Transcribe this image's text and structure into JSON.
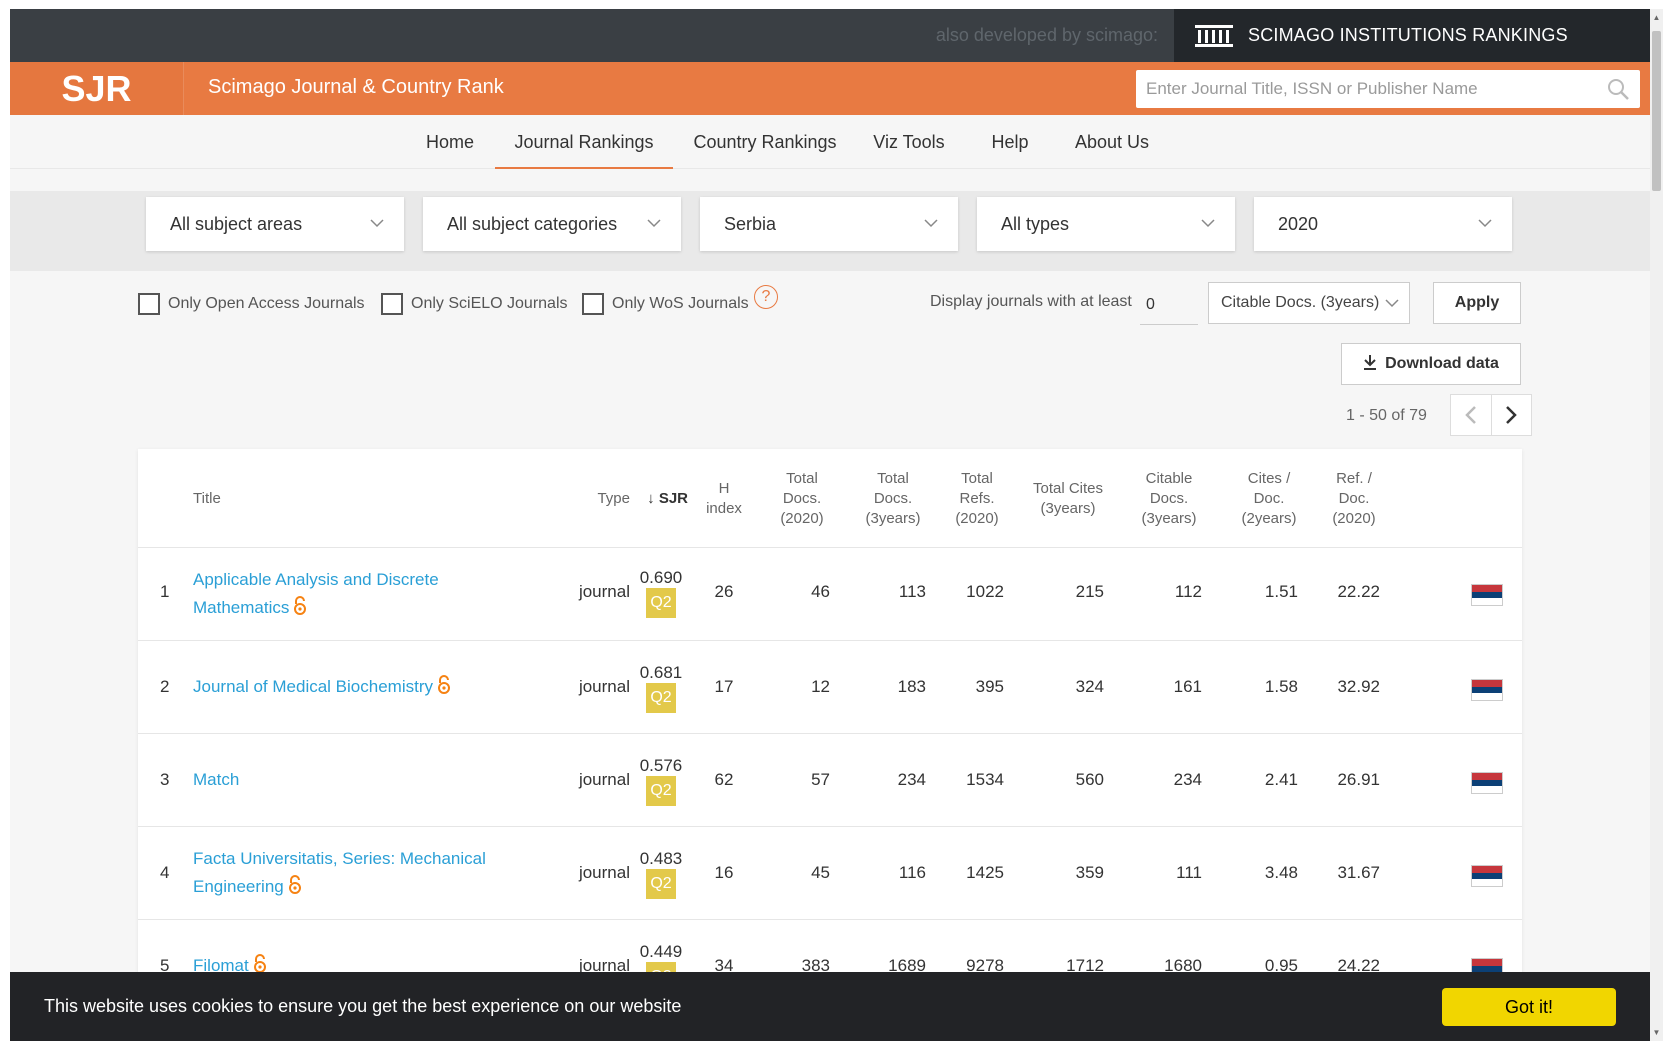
{
  "topbar": {
    "also_developed": "also developed by scimago:",
    "sir_label": "SCIMAGO INSTITUTIONS RANKINGS"
  },
  "header": {
    "logo": "SJR",
    "site_name": "Scimago Journal & Country Rank",
    "search_placeholder": "Enter Journal Title, ISSN or Publisher Name"
  },
  "nav": [
    "Home",
    "Journal Rankings",
    "Country Rankings",
    "Viz Tools",
    "Help",
    "About Us"
  ],
  "nav_active": "Journal Rankings",
  "filters": {
    "subject_area": "All subject areas",
    "subject_category": "All subject categories",
    "country": "Serbia",
    "type": "All types",
    "year": "2020"
  },
  "options": {
    "open_access": "Only Open Access Journals",
    "scielo": "Only SciELO Journals",
    "wos": "Only WoS Journals",
    "help_glyph": "?",
    "display_label": "Display journals with at least",
    "min_value": "0",
    "citable_select": "Citable Docs. (3years)",
    "apply": "Apply",
    "download": "Download data"
  },
  "pagination": {
    "info": "1 - 50 of 79"
  },
  "table": {
    "headers": {
      "title": "Title",
      "type": "Type",
      "sjr": "SJR",
      "h_index": [
        "H",
        "index"
      ],
      "total_docs_2020": [
        "Total",
        "Docs.",
        "(2020)"
      ],
      "total_docs_3y": [
        "Total",
        "Docs.",
        "(3years)"
      ],
      "total_refs": [
        "Total",
        "Refs.",
        "(2020)"
      ],
      "total_cites": [
        "Total Cites",
        "(3years)"
      ],
      "citable_docs": [
        "Citable",
        "Docs.",
        "(3years)"
      ],
      "cites_doc": [
        "Cites /",
        "Doc.",
        "(2years)"
      ],
      "ref_doc": [
        "Ref. /",
        "Doc.",
        "(2020)"
      ]
    },
    "rows": [
      {
        "rank": "1",
        "title_lines": [
          "Applicable Analysis and Discrete",
          "Mathematics"
        ],
        "open_access": true,
        "type": "journal",
        "sjr": "0.690",
        "quartile": "Q2",
        "h_index": "26",
        "total_docs_2020": "46",
        "total_docs_3y": "113",
        "total_refs": "1022",
        "total_cites": "215",
        "citable_docs": "112",
        "cites_doc": "1.51",
        "ref_doc": "22.22"
      },
      {
        "rank": "2",
        "title_lines": [
          "Journal of Medical Biochemistry"
        ],
        "open_access": true,
        "type": "journal",
        "sjr": "0.681",
        "quartile": "Q2",
        "h_index": "17",
        "total_docs_2020": "12",
        "total_docs_3y": "183",
        "total_refs": "395",
        "total_cites": "324",
        "citable_docs": "161",
        "cites_doc": "1.58",
        "ref_doc": "32.92"
      },
      {
        "rank": "3",
        "title_lines": [
          "Match"
        ],
        "open_access": false,
        "type": "journal",
        "sjr": "0.576",
        "quartile": "Q2",
        "h_index": "62",
        "total_docs_2020": "57",
        "total_docs_3y": "234",
        "total_refs": "1534",
        "total_cites": "560",
        "citable_docs": "234",
        "cites_doc": "2.41",
        "ref_doc": "26.91"
      },
      {
        "rank": "4",
        "title_lines": [
          "Facta Universitatis, Series: Mechanical",
          "Engineering"
        ],
        "open_access": true,
        "type": "journal",
        "sjr": "0.483",
        "quartile": "Q2",
        "h_index": "16",
        "total_docs_2020": "45",
        "total_docs_3y": "116",
        "total_refs": "1425",
        "total_cites": "359",
        "citable_docs": "111",
        "cites_doc": "3.48",
        "ref_doc": "31.67"
      },
      {
        "rank": "5",
        "title_lines": [
          "Filomat"
        ],
        "open_access": true,
        "type": "journal",
        "sjr": "0.449",
        "quartile": "Q2",
        "h_index": "34",
        "total_docs_2020": "383",
        "total_docs_3y": "1689",
        "total_refs": "9278",
        "total_cites": "1712",
        "citable_docs": "1680",
        "cites_doc": "0.95",
        "ref_doc": "24.22"
      }
    ]
  },
  "cookie": {
    "text": "This website uses cookies to ensure you get the best experience on our website",
    "button": "Got it!"
  },
  "colors": {
    "brand_orange": "#e87a42",
    "link_blue": "#2a9fd6",
    "quartile_q2": "#e3c94a",
    "cookie_button": "#f1d600",
    "topbar": "#3a3f44"
  },
  "icons": [
    "institution-icon",
    "search-icon",
    "chevron-down-icon",
    "help-icon",
    "download-icon",
    "chevron-left-icon",
    "chevron-right-icon",
    "open-access-icon",
    "serbia-flag-icon",
    "sort-down-arrow-icon"
  ]
}
